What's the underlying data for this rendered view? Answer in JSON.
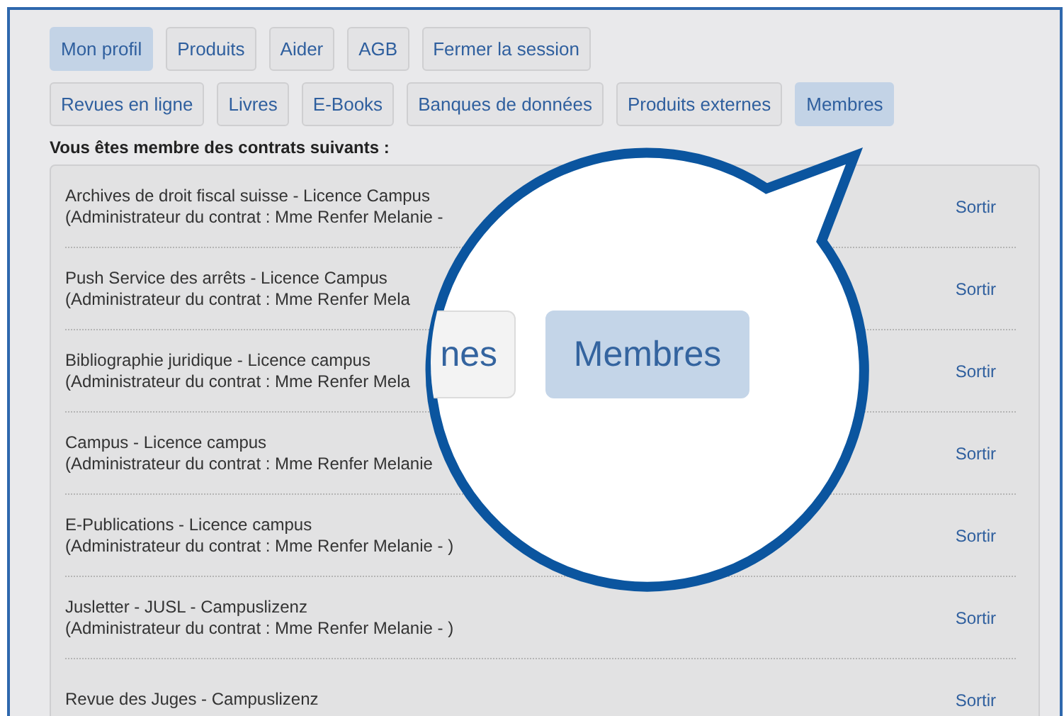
{
  "nav_rows": [
    [
      {
        "label": "Mon profil",
        "selected": true
      },
      {
        "label": "Produits",
        "selected": false
      },
      {
        "label": "Aider",
        "selected": false
      },
      {
        "label": "AGB",
        "selected": false
      },
      {
        "label": "Fermer la session",
        "selected": false
      }
    ],
    [
      {
        "label": "Revues en ligne",
        "selected": false
      },
      {
        "label": "Livres",
        "selected": false
      },
      {
        "label": "E-Books",
        "selected": false
      },
      {
        "label": "Banques de données",
        "selected": false
      },
      {
        "label": "Produits externes",
        "selected": false
      },
      {
        "label": "Membres",
        "selected": true
      }
    ]
  ],
  "heading": "Vous êtes membre des contrats suivants :",
  "contracts": [
    {
      "title": "Archives de droit fiscal suisse - Licence Campus",
      "admin": "(Administrateur du contrat : Mme Renfer Melanie -",
      "action": "Sortir"
    },
    {
      "title": "Push Service des arrêts - Licence Campus",
      "admin": "(Administrateur du contrat : Mme Renfer Mela",
      "action": "Sortir"
    },
    {
      "title": "Bibliographie juridique - Licence campus",
      "admin": "(Administrateur du contrat : Mme Renfer Mela",
      "action": "Sortir"
    },
    {
      "title": "Campus - Licence campus",
      "admin": "(Administrateur du contrat : Mme Renfer Melanie",
      "action": "Sortir"
    },
    {
      "title": "E-Publications - Licence campus",
      "admin": "(Administrateur du contrat : Mme Renfer Melanie - )",
      "action": "Sortir"
    },
    {
      "title": "Jusletter - JUSL - Campuslizenz",
      "admin": "(Administrateur du contrat : Mme Renfer Melanie - )",
      "action": "Sortir"
    },
    {
      "title": "Revue des Juges - Campuslizenz",
      "action": "Sortir"
    }
  ],
  "magnifier": {
    "buttons": [
      {
        "label": "nes",
        "selected": false
      },
      {
        "label": "Membres",
        "selected": true
      }
    ]
  }
}
